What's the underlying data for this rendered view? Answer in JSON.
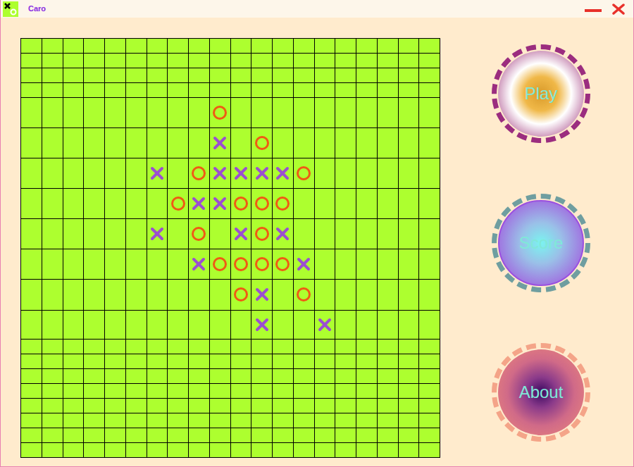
{
  "window": {
    "title": "Caro"
  },
  "board": {
    "cells": [
      "....................",
      "....................",
      "....................",
      "....................",
      ".........O..........",
      ".........X.O........",
      "......X.OXXXXO......",
      ".......OXXOOO.......",
      "......X.O.XOX.......",
      "........XOOOOX......",
      "..........OX.O......",
      "...........X..X.....",
      "....................",
      "....................",
      "....................",
      "....................",
      "....................",
      "....................",
      "....................",
      "...................."
    ]
  },
  "buttons": [
    {
      "label": "Play",
      "kind": "play"
    },
    {
      "label": "Score",
      "kind": "score"
    },
    {
      "label": "About",
      "kind": "about"
    }
  ]
}
